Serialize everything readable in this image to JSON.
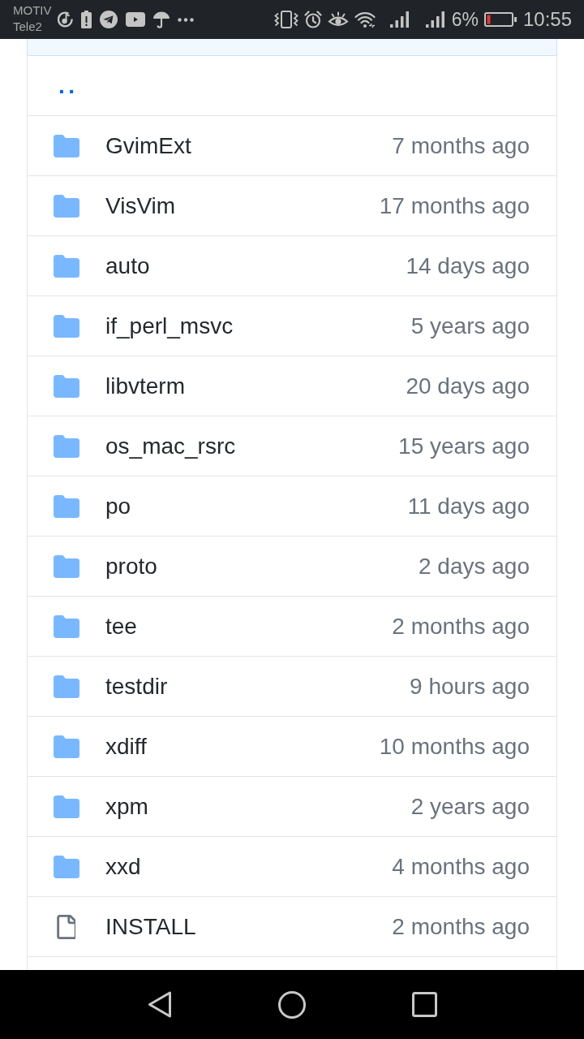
{
  "status_bar": {
    "carrier": [
      "MOTIV",
      "Tele2"
    ],
    "battery_percent": "6%",
    "time": "10:55"
  },
  "file_list": {
    "parent_link": "..",
    "items": [
      {
        "kind": "folder",
        "name": "GvimExt",
        "age": "7 months ago"
      },
      {
        "kind": "folder",
        "name": "VisVim",
        "age": "17 months ago"
      },
      {
        "kind": "folder",
        "name": "auto",
        "age": "14 days ago"
      },
      {
        "kind": "folder",
        "name": "if_perl_msvc",
        "age": "5 years ago"
      },
      {
        "kind": "folder",
        "name": "libvterm",
        "age": "20 days ago"
      },
      {
        "kind": "folder",
        "name": "os_mac_rsrc",
        "age": "15 years ago"
      },
      {
        "kind": "folder",
        "name": "po",
        "age": "11 days ago"
      },
      {
        "kind": "folder",
        "name": "proto",
        "age": "2 days ago"
      },
      {
        "kind": "folder",
        "name": "tee",
        "age": "2 months ago"
      },
      {
        "kind": "folder",
        "name": "testdir",
        "age": "9 hours ago"
      },
      {
        "kind": "folder",
        "name": "xdiff",
        "age": "10 months ago"
      },
      {
        "kind": "folder",
        "name": "xpm",
        "age": "2 years ago"
      },
      {
        "kind": "folder",
        "name": "xxd",
        "age": "4 months ago"
      },
      {
        "kind": "file",
        "name": "INSTALL",
        "age": "2 months ago"
      }
    ]
  }
}
